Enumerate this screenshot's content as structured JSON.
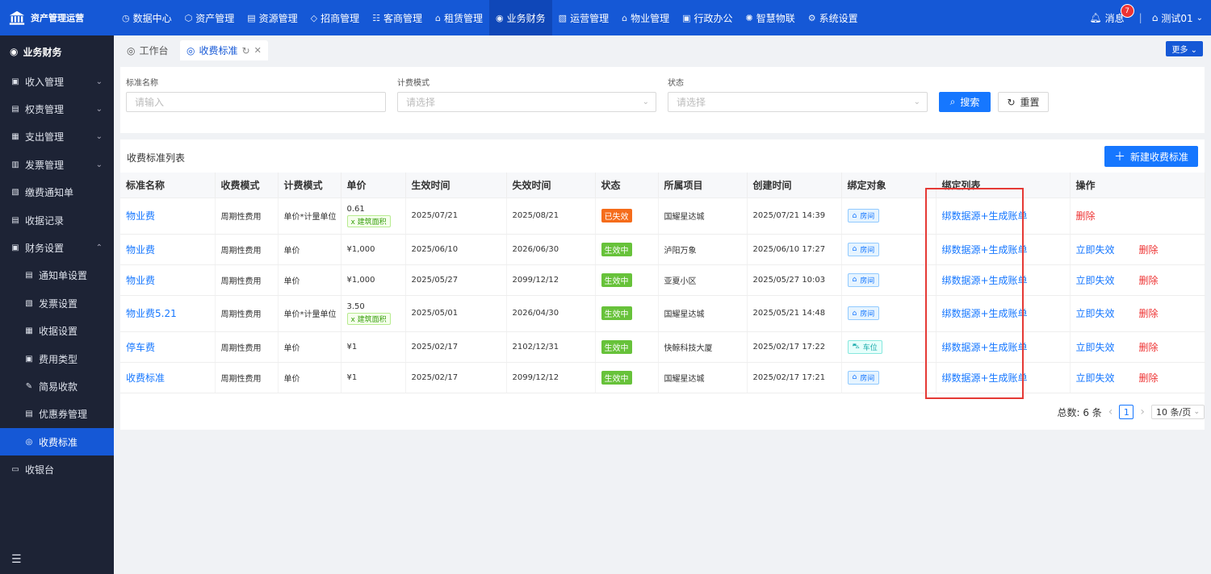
{
  "app": {
    "title": "资产管理运营"
  },
  "topnav": [
    {
      "icon": "◷",
      "label": "数据中心"
    },
    {
      "icon": "⬡",
      "label": "资产管理"
    },
    {
      "icon": "▤",
      "label": "资源管理"
    },
    {
      "icon": "◇",
      "label": "招商管理"
    },
    {
      "icon": "☷",
      "label": "客商管理"
    },
    {
      "icon": "⌂",
      "label": "租赁管理"
    },
    {
      "icon": "◉",
      "label": "业务财务"
    },
    {
      "icon": "▧",
      "label": "运营管理"
    },
    {
      "icon": "⌂",
      "label": "物业管理"
    },
    {
      "icon": "▣",
      "label": "行政办公"
    },
    {
      "icon": "✺",
      "label": "智慧物联"
    },
    {
      "icon": "⚙",
      "label": "系统设置"
    }
  ],
  "top_right": {
    "messages_label": "消息",
    "message_count": "7",
    "user_label": "测试01"
  },
  "sidebar": {
    "title": "业务财务",
    "items": [
      {
        "icon": "▣",
        "label": "收入管理",
        "arrow": "⌄"
      },
      {
        "icon": "▤",
        "label": "权责管理",
        "arrow": "⌄"
      },
      {
        "icon": "▦",
        "label": "支出管理",
        "arrow": "⌄"
      },
      {
        "icon": "▥",
        "label": "发票管理",
        "arrow": "⌄"
      },
      {
        "icon": "▧",
        "label": "缴费通知单",
        "arrow": ""
      },
      {
        "icon": "▤",
        "label": "收据记录",
        "arrow": ""
      },
      {
        "icon": "▣",
        "label": "财务设置",
        "arrow": "⌃"
      }
    ],
    "sub_items": [
      {
        "icon": "▤",
        "label": "通知单设置"
      },
      {
        "icon": "▧",
        "label": "发票设置"
      },
      {
        "icon": "▦",
        "label": "收据设置"
      },
      {
        "icon": "▣",
        "label": "费用类型"
      },
      {
        "icon": "✎",
        "label": "简易收款"
      },
      {
        "icon": "▤",
        "label": "优惠券管理"
      },
      {
        "icon": "◎",
        "label": "收费标准"
      }
    ],
    "after_items": [
      {
        "icon": "▭",
        "label": "收银台"
      }
    ]
  },
  "tabs": [
    {
      "icon": "◎",
      "label": "工作台"
    },
    {
      "icon": "◎",
      "label": "收费标准",
      "refresh": "↻",
      "close": "✕"
    }
  ],
  "more_label": "更多 ⌄",
  "search": {
    "name_label": "标准名称",
    "name_placeholder": "请输入",
    "mode_label": "计费模式",
    "mode_placeholder": "请选择",
    "status_label": "状态",
    "status_placeholder": "请选择",
    "search_btn": "搜索",
    "reset_btn": "重置"
  },
  "list": {
    "title": "收费标准列表",
    "new_btn": "新建收费标准",
    "columns": [
      "标准名称",
      "收费模式",
      "计费模式",
      "单价",
      "生效时间",
      "失效时间",
      "状态",
      "所属项目",
      "创建时间",
      "绑定对象",
      "绑定列表",
      "操作"
    ],
    "rows": [
      {
        "name": "物业费",
        "charge_mode": "周期性费用",
        "bill_mode": "单价*计量单位",
        "price": "0.61",
        "price_tag": "x 建筑面积",
        "start": "2025/07/21",
        "end": "2025/08/21",
        "status": "已失效",
        "status_color": "#f56c1b",
        "project": "国耀星达城",
        "created": "2025/07/21 14:39",
        "obj_icon": "⌂",
        "obj": "房间",
        "obj_type": "room",
        "bind": "绑数据源+生成账单",
        "op1": "",
        "op2": "删除"
      },
      {
        "name": "物业费",
        "charge_mode": "周期性费用",
        "bill_mode": "单价",
        "price": "¥1,000",
        "price_tag": "",
        "start": "2025/06/10",
        "end": "2026/06/30",
        "status": "生效中",
        "status_color": "#67c23a",
        "project": "泸阳万象",
        "created": "2025/06/10 17:27",
        "obj_icon": "⌂",
        "obj": "房间",
        "obj_type": "room",
        "bind": "绑数据源+生成账单",
        "op1": "立即失效",
        "op2": "删除"
      },
      {
        "name": "物业费",
        "charge_mode": "周期性费用",
        "bill_mode": "单价",
        "price": "¥1,000",
        "price_tag": "",
        "start": "2025/05/27",
        "end": "2099/12/12",
        "status": "生效中",
        "status_color": "#67c23a",
        "project": "亚夏小区",
        "created": "2025/05/27 10:03",
        "obj_icon": "⌂",
        "obj": "房间",
        "obj_type": "room",
        "bind": "绑数据源+生成账单",
        "op1": "立即失效",
        "op2": "删除"
      },
      {
        "name": "物业费5.21",
        "charge_mode": "周期性费用",
        "bill_mode": "单价*计量单位",
        "price": "3.50",
        "price_tag": "x 建筑面积",
        "start": "2025/05/01",
        "end": "2026/04/30",
        "status": "生效中",
        "status_color": "#67c23a",
        "project": "国耀星达城",
        "created": "2025/05/21 14:48",
        "obj_icon": "⌂",
        "obj": "房间",
        "obj_type": "room",
        "bind": "绑数据源+生成账单",
        "op1": "立即失效",
        "op2": "删除"
      },
      {
        "name": "停车费",
        "charge_mode": "周期性费用",
        "bill_mode": "单价",
        "price": "¥1",
        "price_tag": "",
        "start": "2025/02/17",
        "end": "2102/12/31",
        "status": "生效中",
        "status_color": "#67c23a",
        "project": "快鲸科技大厦",
        "created": "2025/02/17 17:22",
        "obj_icon": "⛍",
        "obj": "车位",
        "obj_type": "parking",
        "bind": "绑数据源+生成账单",
        "op1": "立即失效",
        "op2": "删除"
      },
      {
        "name": "收费标准",
        "charge_mode": "周期性费用",
        "bill_mode": "单价",
        "price": "¥1",
        "price_tag": "",
        "start": "2025/02/17",
        "end": "2099/12/12",
        "status": "生效中",
        "status_color": "#67c23a",
        "project": "国耀星达城",
        "created": "2025/02/17 17:21",
        "obj_icon": "⌂",
        "obj": "房间",
        "obj_type": "room",
        "bind": "绑数据源+生成账单",
        "op1": "立即失效",
        "op2": "删除"
      }
    ]
  },
  "pager": {
    "total": "总数: 6 条",
    "prev": "‹",
    "page": "1",
    "next": "›",
    "size": "10 条/页"
  }
}
